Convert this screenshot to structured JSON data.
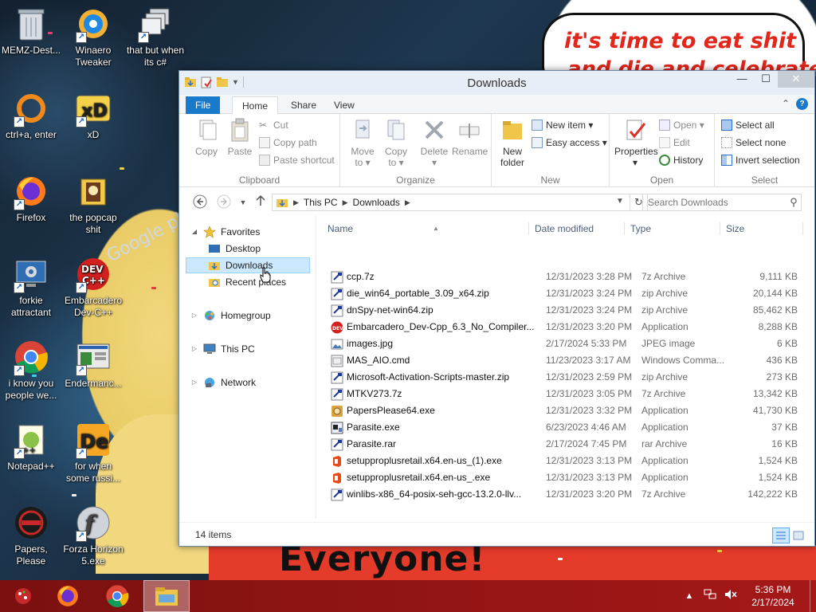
{
  "desktop": {
    "background_banner_text": "Everyone!",
    "speech_text_line1": "it's time to eat shit",
    "speech_text_line2": "and die and celebrate",
    "graffiti_text": "Google play",
    "icons": [
      {
        "label": "MEMZ-Dest...",
        "icon": "recycle-bin-icon"
      },
      {
        "label": "Winaero Tweaker",
        "icon": "winaero-tweaker-icon"
      },
      {
        "label": "that but when its c#",
        "icon": "stacked-windows-icon"
      },
      {
        "label": "ctrl+a, enter",
        "icon": "orange-ring-icon"
      },
      {
        "label": "xD",
        "icon": "xd-app-icon"
      },
      {
        "label": "Firefox",
        "icon": "firefox-icon"
      },
      {
        "label": "the popcap shit",
        "icon": "popcap-folder-icon"
      },
      {
        "label": "forkie attractant",
        "icon": "gear-monitor-icon"
      },
      {
        "label": "Embarcadero Dev-C++",
        "icon": "devcpp-icon"
      },
      {
        "label": "i know you people we...",
        "icon": "chrome-icon"
      },
      {
        "label": "Endermanc...",
        "icon": "endermanch-icon"
      },
      {
        "label": "Notepad++",
        "icon": "notepadpp-icon"
      },
      {
        "label": "for when some russi...",
        "icon": "de-app-icon"
      },
      {
        "label": "Papers, Please",
        "icon": "papers-please-icon"
      },
      {
        "label": "Forza Horizon 5.exe",
        "icon": "flash-icon"
      }
    ]
  },
  "window": {
    "title": "Downloads",
    "controls": {
      "minimize": "—",
      "maximize": "☐",
      "close": "✕"
    },
    "ribbon_tabs": [
      "File",
      "Home",
      "Share",
      "View"
    ],
    "ribbon": {
      "clipboard": {
        "label": "Clipboard",
        "copy": "Copy",
        "paste": "Paste",
        "cut": "Cut",
        "copy_path": "Copy path",
        "paste_shortcut": "Paste shortcut"
      },
      "organize": {
        "label": "Organize",
        "move_to_line1": "Move",
        "move_to_line2": "to ▾",
        "copy_to_line1": "Copy",
        "copy_to_line2": "to ▾",
        "delete_line1": "Delete",
        "delete_line2": "▾",
        "rename": "Rename"
      },
      "new": {
        "label": "New",
        "new_folder_line1": "New",
        "new_folder_line2": "folder",
        "new_item": "New item ▾",
        "easy_access": "Easy access ▾"
      },
      "open": {
        "label": "Open",
        "properties_line1": "Properties",
        "properties_line2": "▾",
        "open": "Open ▾",
        "edit": "Edit",
        "history": "History"
      },
      "select": {
        "label": "Select",
        "select_all": "Select all",
        "select_none": "Select none",
        "invert_selection": "Invert selection"
      }
    },
    "address": {
      "crumbs": [
        "This PC",
        "Downloads"
      ],
      "search_placeholder": "Search Downloads"
    },
    "nav": {
      "favorites": "Favorites",
      "desktop": "Desktop",
      "downloads": "Downloads",
      "recent_places": "Recent places",
      "homegroup": "Homegroup",
      "this_pc": "This PC",
      "network": "Network"
    },
    "columns": {
      "name": "Name",
      "date": "Date modified",
      "type": "Type",
      "size": "Size"
    },
    "files": [
      {
        "name": "ccp.7z",
        "date": "12/31/2023 3:28 PM",
        "type": "7z Archive",
        "size": "9,111 KB",
        "icon": "archive"
      },
      {
        "name": "die_win64_portable_3.09_x64.zip",
        "date": "12/31/2023 3:24 PM",
        "type": "zip Archive",
        "size": "20,144 KB",
        "icon": "archive"
      },
      {
        "name": "dnSpy-net-win64.zip",
        "date": "12/31/2023 3:24 PM",
        "type": "zip Archive",
        "size": "85,462 KB",
        "icon": "archive"
      },
      {
        "name": "Embarcadero_Dev-Cpp_6.3_No_Compiler...",
        "date": "12/31/2023 3:20 PM",
        "type": "Application",
        "size": "8,288 KB",
        "icon": "devcpp"
      },
      {
        "name": "images.jpg",
        "date": "2/17/2024 5:33 PM",
        "type": "JPEG image",
        "size": "6 KB",
        "icon": "image"
      },
      {
        "name": "MAS_AIO.cmd",
        "date": "11/23/2023 3:17 AM",
        "type": "Windows Comma...",
        "size": "436 KB",
        "icon": "cmd"
      },
      {
        "name": "Microsoft-Activation-Scripts-master.zip",
        "date": "12/31/2023 2:59 PM",
        "type": "zip Archive",
        "size": "273 KB",
        "icon": "archive"
      },
      {
        "name": "MTKV273.7z",
        "date": "12/31/2023 3:05 PM",
        "type": "7z Archive",
        "size": "13,342 KB",
        "icon": "archive"
      },
      {
        "name": "PapersPlease64.exe",
        "date": "12/31/2023 3:32 PM",
        "type": "Application",
        "size": "41,730 KB",
        "icon": "papers"
      },
      {
        "name": "Parasite.exe",
        "date": "6/23/2023 4:46 AM",
        "type": "Application",
        "size": "37 KB",
        "icon": "exe"
      },
      {
        "name": "Parasite.rar",
        "date": "2/17/2024 7:45 PM",
        "type": "rar Archive",
        "size": "16 KB",
        "icon": "archive"
      },
      {
        "name": "setupproplusretail.x64.en-us_(1).exe",
        "date": "12/31/2023 3:13 PM",
        "type": "Application",
        "size": "1,524 KB",
        "icon": "office"
      },
      {
        "name": "setupproplusretail.x64.en-us_.exe",
        "date": "12/31/2023 3:13 PM",
        "type": "Application",
        "size": "1,524 KB",
        "icon": "office"
      },
      {
        "name": "winlibs-x86_64-posix-seh-gcc-13.2.0-llv...",
        "date": "12/31/2023 3:20 PM",
        "type": "7z Archive",
        "size": "142,222 KB",
        "icon": "archive"
      }
    ],
    "status": "14 items"
  },
  "taskbar": {
    "time": "5:36 PM",
    "date": "2/17/2024"
  },
  "colors": {
    "accent": "#1979ca",
    "selection": "#cce8ff",
    "taskbar": "#8e1414"
  }
}
